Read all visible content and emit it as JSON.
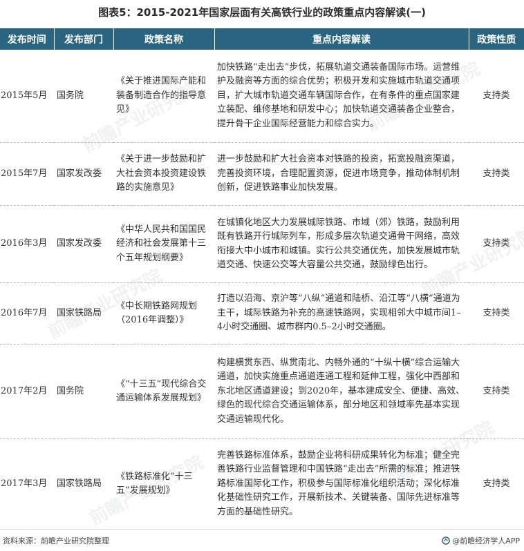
{
  "title": "图表5：2015-2021年国家层面有关高铁行业的政策重点内容解读(一)",
  "table": {
    "headers": [
      "发布时间",
      "发布部门",
      "政策名称",
      "重点内容解读",
      "政策性质"
    ],
    "rows": [
      {
        "date": "2015年5月",
        "dept": "国务院",
        "name": "《关于推进国际产能和装备制造合作的指导意见》",
        "content": "加快铁路“走出去”步伐，拓展轨道交通装备国际市场。运营维护及融资等方面的综合优势；积极开发和实施城市轨道交通项目，扩大城市轨道交通车辆国际合作，在有条件的重点国家建立装配、维修基地和研发中心；加快轨道交通装备企业整合，提升骨干企业国际经营能力和综合实力。",
        "nature": "支持类"
      },
      {
        "date": "2015年7月",
        "dept": "国家发改委",
        "name": "《关于进一步鼓励和扩大社会资本投资建设铁路的实施意见》",
        "content": "进一步鼓励和扩大社会资本对铁路的投资，拓宽投融资渠道，完善投资环境，合理配置资源，促进市场竞争，推动体制机制创新，促进铁路事业加快发展。",
        "nature": "支持类"
      },
      {
        "date": "2016年3月",
        "dept": "国家发改委",
        "name": "《中华人民共和国国民经济和社会发展第十三个五年规划纲要》",
        "content": "在城镇化地区大力发展城际铁路、市域（郊）铁路，鼓励利用既有铁路开行城际列车，形成多层次轨道交通骨干网络，高效衔接大中小城市和城镇。实行公共交通优先，加快发展城市轨道交通、快速公交等大容量公共交通，鼓励绿色出行。",
        "nature": "支持类"
      },
      {
        "date": "2016年7月",
        "dept": "国家铁路局",
        "name": "《中长期铁路网规划（2016年调整）》",
        "content": "打造以沿海、京沪等“八纵”通道和陆桥、沿江等“八横”通道为主干，城际铁路为补充的高速铁路网，实现相邻大中城市间1–4小时交通圈、城市群内0.5–2小时交通圈。",
        "nature": "支持类"
      },
      {
        "date": "2017年2月",
        "dept": "国务院",
        "name": "《“十三五”现代综合交通运输体系发展规划》",
        "content": "构建横贯东西、纵贯南北、内畅外通的“十纵十横”综合运输大通道，加快实施重点通道连通工程和延伸工程，强化中西部和东北地区通道建设；到2020年，基本建成安全、便捷、高效、绿色的现代综合交通运输体系，部分地区和领域率先基本实现交通运输现代化。",
        "nature": "支持类"
      },
      {
        "date": "2017年3月",
        "dept": "国家铁路局",
        "name": "《铁路标准化“十三五”发展规划》",
        "content": "完善铁路标准体系，鼓励企业将科研成果转化为标准；健全完善铁路行业监督管理和中国铁路“走出去”所需的标准；推进铁路标准国际化工作，积极参与国际标准化组织活动；深化标准化基础性研究工作，开展新技术、关键装备、国际先进标准等方面的基础性研究。",
        "nature": "支持类"
      }
    ]
  },
  "footer": {
    "source": "资料来源：前瞻产业研究院整理",
    "brand": "@前瞻经济学人APP"
  },
  "watermark": {
    "text": "前瞻产业研究院"
  }
}
